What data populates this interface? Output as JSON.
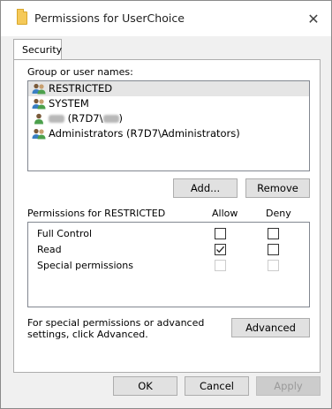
{
  "window": {
    "title": "Permissions for UserChoice",
    "close_glyph": "✕"
  },
  "tabs": [
    {
      "label": "Security",
      "selected": true
    }
  ],
  "group_section": {
    "label": "Group or user names:",
    "items": [
      {
        "name": "RESTRICTED",
        "icon": "group-icon",
        "selected": true
      },
      {
        "name": "SYSTEM",
        "icon": "group-icon",
        "selected": false
      },
      {
        "name_prefix": "",
        "name_middle": " (R7D7\\",
        "name_suffix": ")",
        "icon": "user-icon",
        "selected": false,
        "redacted": true
      },
      {
        "name": "Administrators (R7D7\\Administrators)",
        "icon": "group-icon",
        "selected": false
      }
    ],
    "add_button": "Add...",
    "remove_button": "Remove"
  },
  "permissions": {
    "header_label": "Permissions for RESTRICTED",
    "allow_header": "Allow",
    "deny_header": "Deny",
    "rows": [
      {
        "label": "Full Control",
        "allow": false,
        "deny": false,
        "enabled": true
      },
      {
        "label": "Read",
        "allow": true,
        "deny": false,
        "enabled": true
      },
      {
        "label": "Special permissions",
        "allow": false,
        "deny": false,
        "enabled": false
      }
    ]
  },
  "advanced": {
    "note": "For special permissions or advanced settings, click Advanced.",
    "button": "Advanced"
  },
  "footer": {
    "ok": "OK",
    "cancel": "Cancel",
    "apply": "Apply"
  },
  "colors": {
    "selected_row": "#e5e5e5",
    "folder_icon": "#f5c959",
    "button_face": "#e1e1e1"
  }
}
